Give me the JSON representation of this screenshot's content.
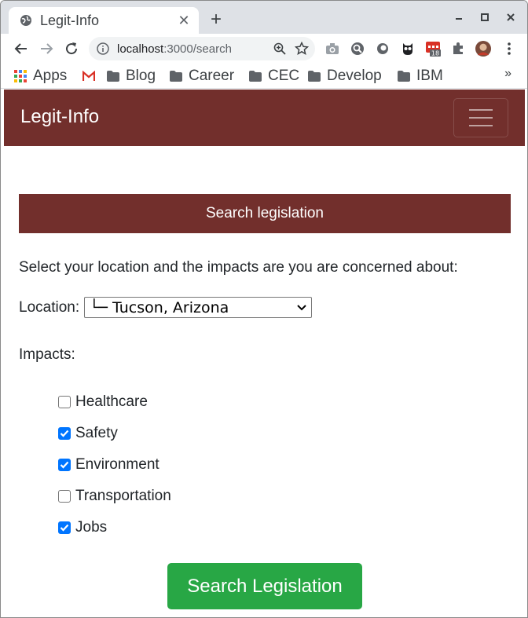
{
  "browser": {
    "tab_title": "Legit-Info",
    "url_host": "localhost",
    "url_path": ":3000/search",
    "extension_badge": "18",
    "bookmarks": [
      "Apps",
      "Blog",
      "Career",
      "CEC",
      "Develop",
      "IBM"
    ],
    "bookmarks_more": "»"
  },
  "app": {
    "brand": "Legit-Info",
    "search_header": "Search legislation",
    "intro": "Select your location and the impacts are you are concerned about:",
    "location_label": "Location:",
    "location_value": "└─ Tucson, Arizona",
    "impacts_label": "Impacts:",
    "impacts": [
      {
        "label": "Healthcare",
        "checked": false
      },
      {
        "label": "Safety",
        "checked": true
      },
      {
        "label": "Environment",
        "checked": true
      },
      {
        "label": "Transportation",
        "checked": false
      },
      {
        "label": "Jobs",
        "checked": true
      }
    ],
    "submit_label": "Search Legislation"
  },
  "colors": {
    "brand": "#722f2c",
    "success": "#28a745",
    "checkbox": "#0075ff"
  }
}
